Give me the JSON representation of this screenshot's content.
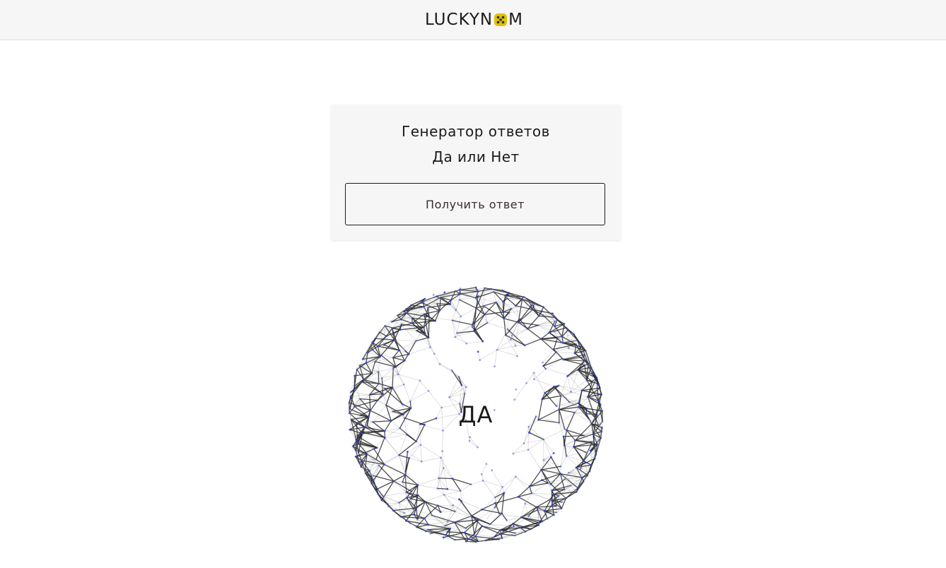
{
  "header": {
    "logo_prefix": "LUCKYN",
    "logo_suffix": "M",
    "logo_icon": "dice-icon",
    "accent_color": "#e0c200"
  },
  "generator": {
    "title": "Генератор ответов",
    "subtitle": "Да или Нет",
    "button_label": "Получить ответ"
  },
  "result": {
    "answer": "ДА",
    "visual": "wireframe-sphere",
    "node_color": "#3340d6",
    "edge_color": "#222222"
  }
}
